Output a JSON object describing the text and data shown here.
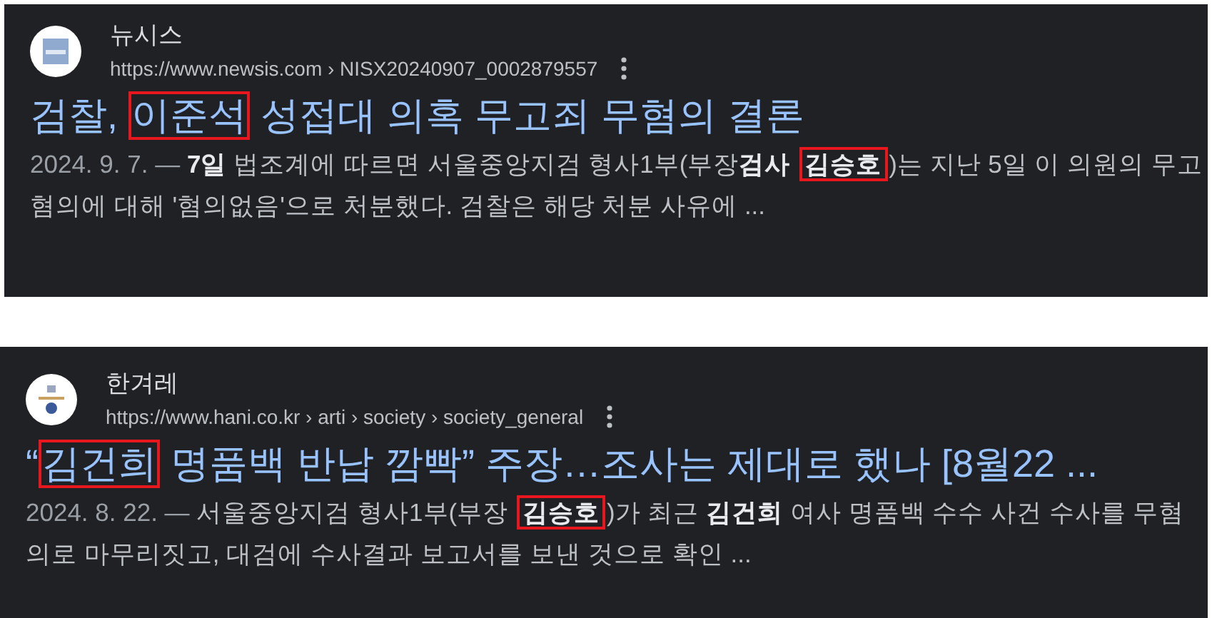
{
  "results": [
    {
      "source": "뉴시스",
      "url": "https://www.newsis.com › NISX20240907_0002879557",
      "kind": "newsis",
      "title": [
        {
          "text": "검찰, ",
          "highlighted": false
        },
        {
          "text": "이준석",
          "highlighted": true
        },
        {
          "text": " 성접대 의혹 무고죄 무혐의 결론",
          "highlighted": false
        }
      ],
      "date": "2024. 9. 7. — ",
      "snippet": [
        {
          "text": "7일",
          "bold": true,
          "highlighted": false
        },
        {
          "text": " 법조계에 따르면 서울중앙지검 형사1부(부장",
          "bold": false,
          "highlighted": false
        },
        {
          "text": "검사 ",
          "bold": true,
          "highlighted": false
        },
        {
          "text": "김승호",
          "bold": true,
          "highlighted": true
        },
        {
          "text": ")는 지난 5일 이 의원의 무고 혐의에 대해 '혐의없음'으로 처분했다. 검찰은 해당 처분 사유에 ...",
          "bold": false,
          "highlighted": false
        }
      ]
    },
    {
      "source": "한겨레",
      "url": "https://www.hani.co.kr › arti › society › society_general",
      "kind": "hani",
      "title": [
        {
          "text": "“",
          "highlighted": false
        },
        {
          "text": "김건희",
          "highlighted": true
        },
        {
          "text": " 명품백 반납 깜빡” 주장…조사는 제대로 했나 [8월22 ...",
          "highlighted": false
        }
      ],
      "date": "2024. 8. 22. — ",
      "snippet": [
        {
          "text": "서울중앙지검 형사1부(부장 ",
          "bold": false,
          "highlighted": false
        },
        {
          "text": "김승호",
          "bold": true,
          "highlighted": true
        },
        {
          "text": ")가 최근 ",
          "bold": false,
          "highlighted": false
        },
        {
          "text": "김건희",
          "bold": true,
          "highlighted": false
        },
        {
          "text": " 여사 명품백 수수 사건 수사를 무혐의로 마무리짓고, 대검에 수사결과 보고서를 보낸 것으로 확인 ...",
          "bold": false,
          "highlighted": false
        }
      ]
    }
  ]
}
